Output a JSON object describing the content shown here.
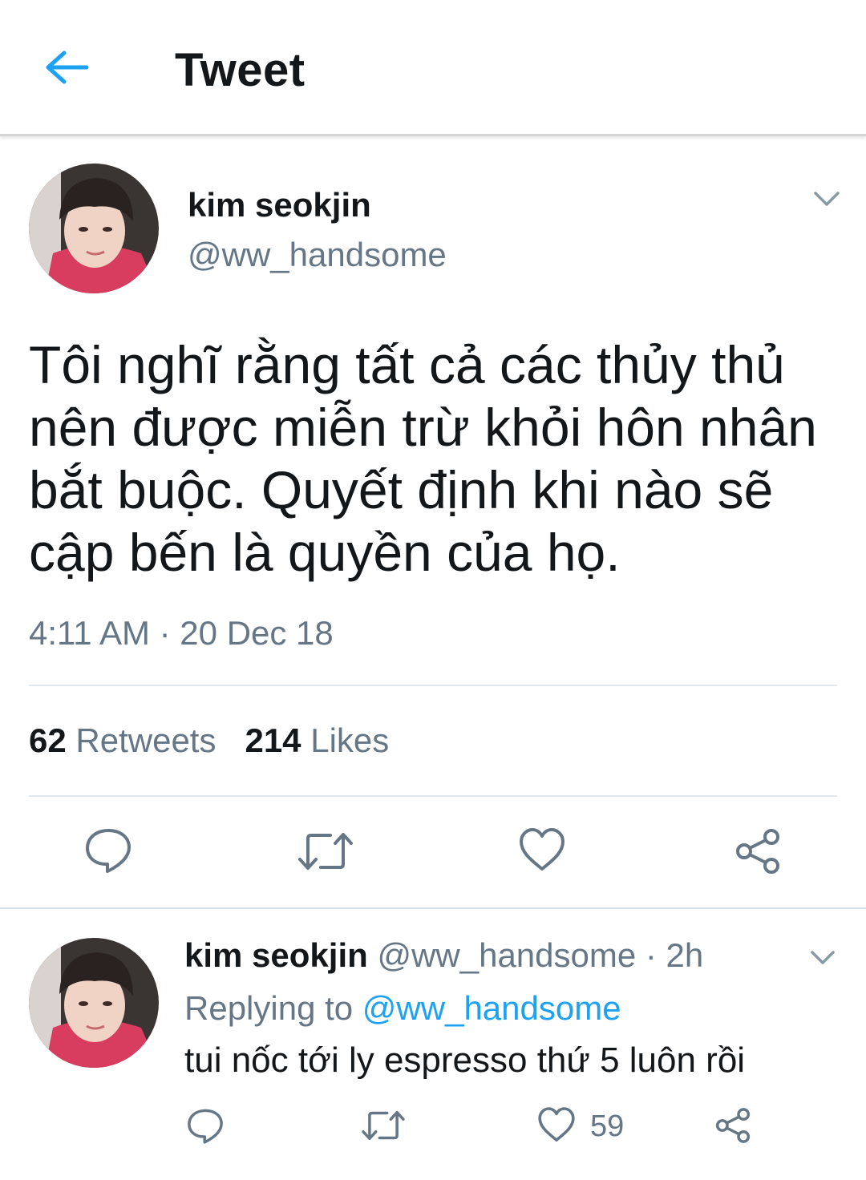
{
  "header": {
    "title": "Tweet",
    "back_icon": "arrow-left-icon",
    "accent": "#1da1f2"
  },
  "tweet": {
    "author_name": "kim seokjin",
    "author_handle": "@ww_handsome",
    "text": "Tôi nghĩ rằng tất cả các thủy thủ nên được miễn trừ khỏi hôn nhân bắt buộc. Quyết định khi nào sẽ cập bến là quyền của họ.",
    "timestamp": "4:11 AM · 20 Dec 18",
    "retweets_count": "62",
    "retweets_label": "Retweets",
    "likes_count": "214",
    "likes_label": "Likes",
    "actions": [
      "reply-icon",
      "retweet-icon",
      "like-icon",
      "share-icon"
    ]
  },
  "reply": {
    "author_name": "kim seokjin",
    "author_handle_time": "@ww_handsome · 2h",
    "replying_label": "Replying to",
    "replying_to": "@ww_handsome",
    "text": "tui nốc tới ly espresso thứ 5 luôn rồi",
    "likes_count": "59"
  },
  "colors": {
    "text": "#14171a",
    "secondary": "#657786",
    "divider": "#e1e8ed",
    "link": "#1da1f2"
  }
}
